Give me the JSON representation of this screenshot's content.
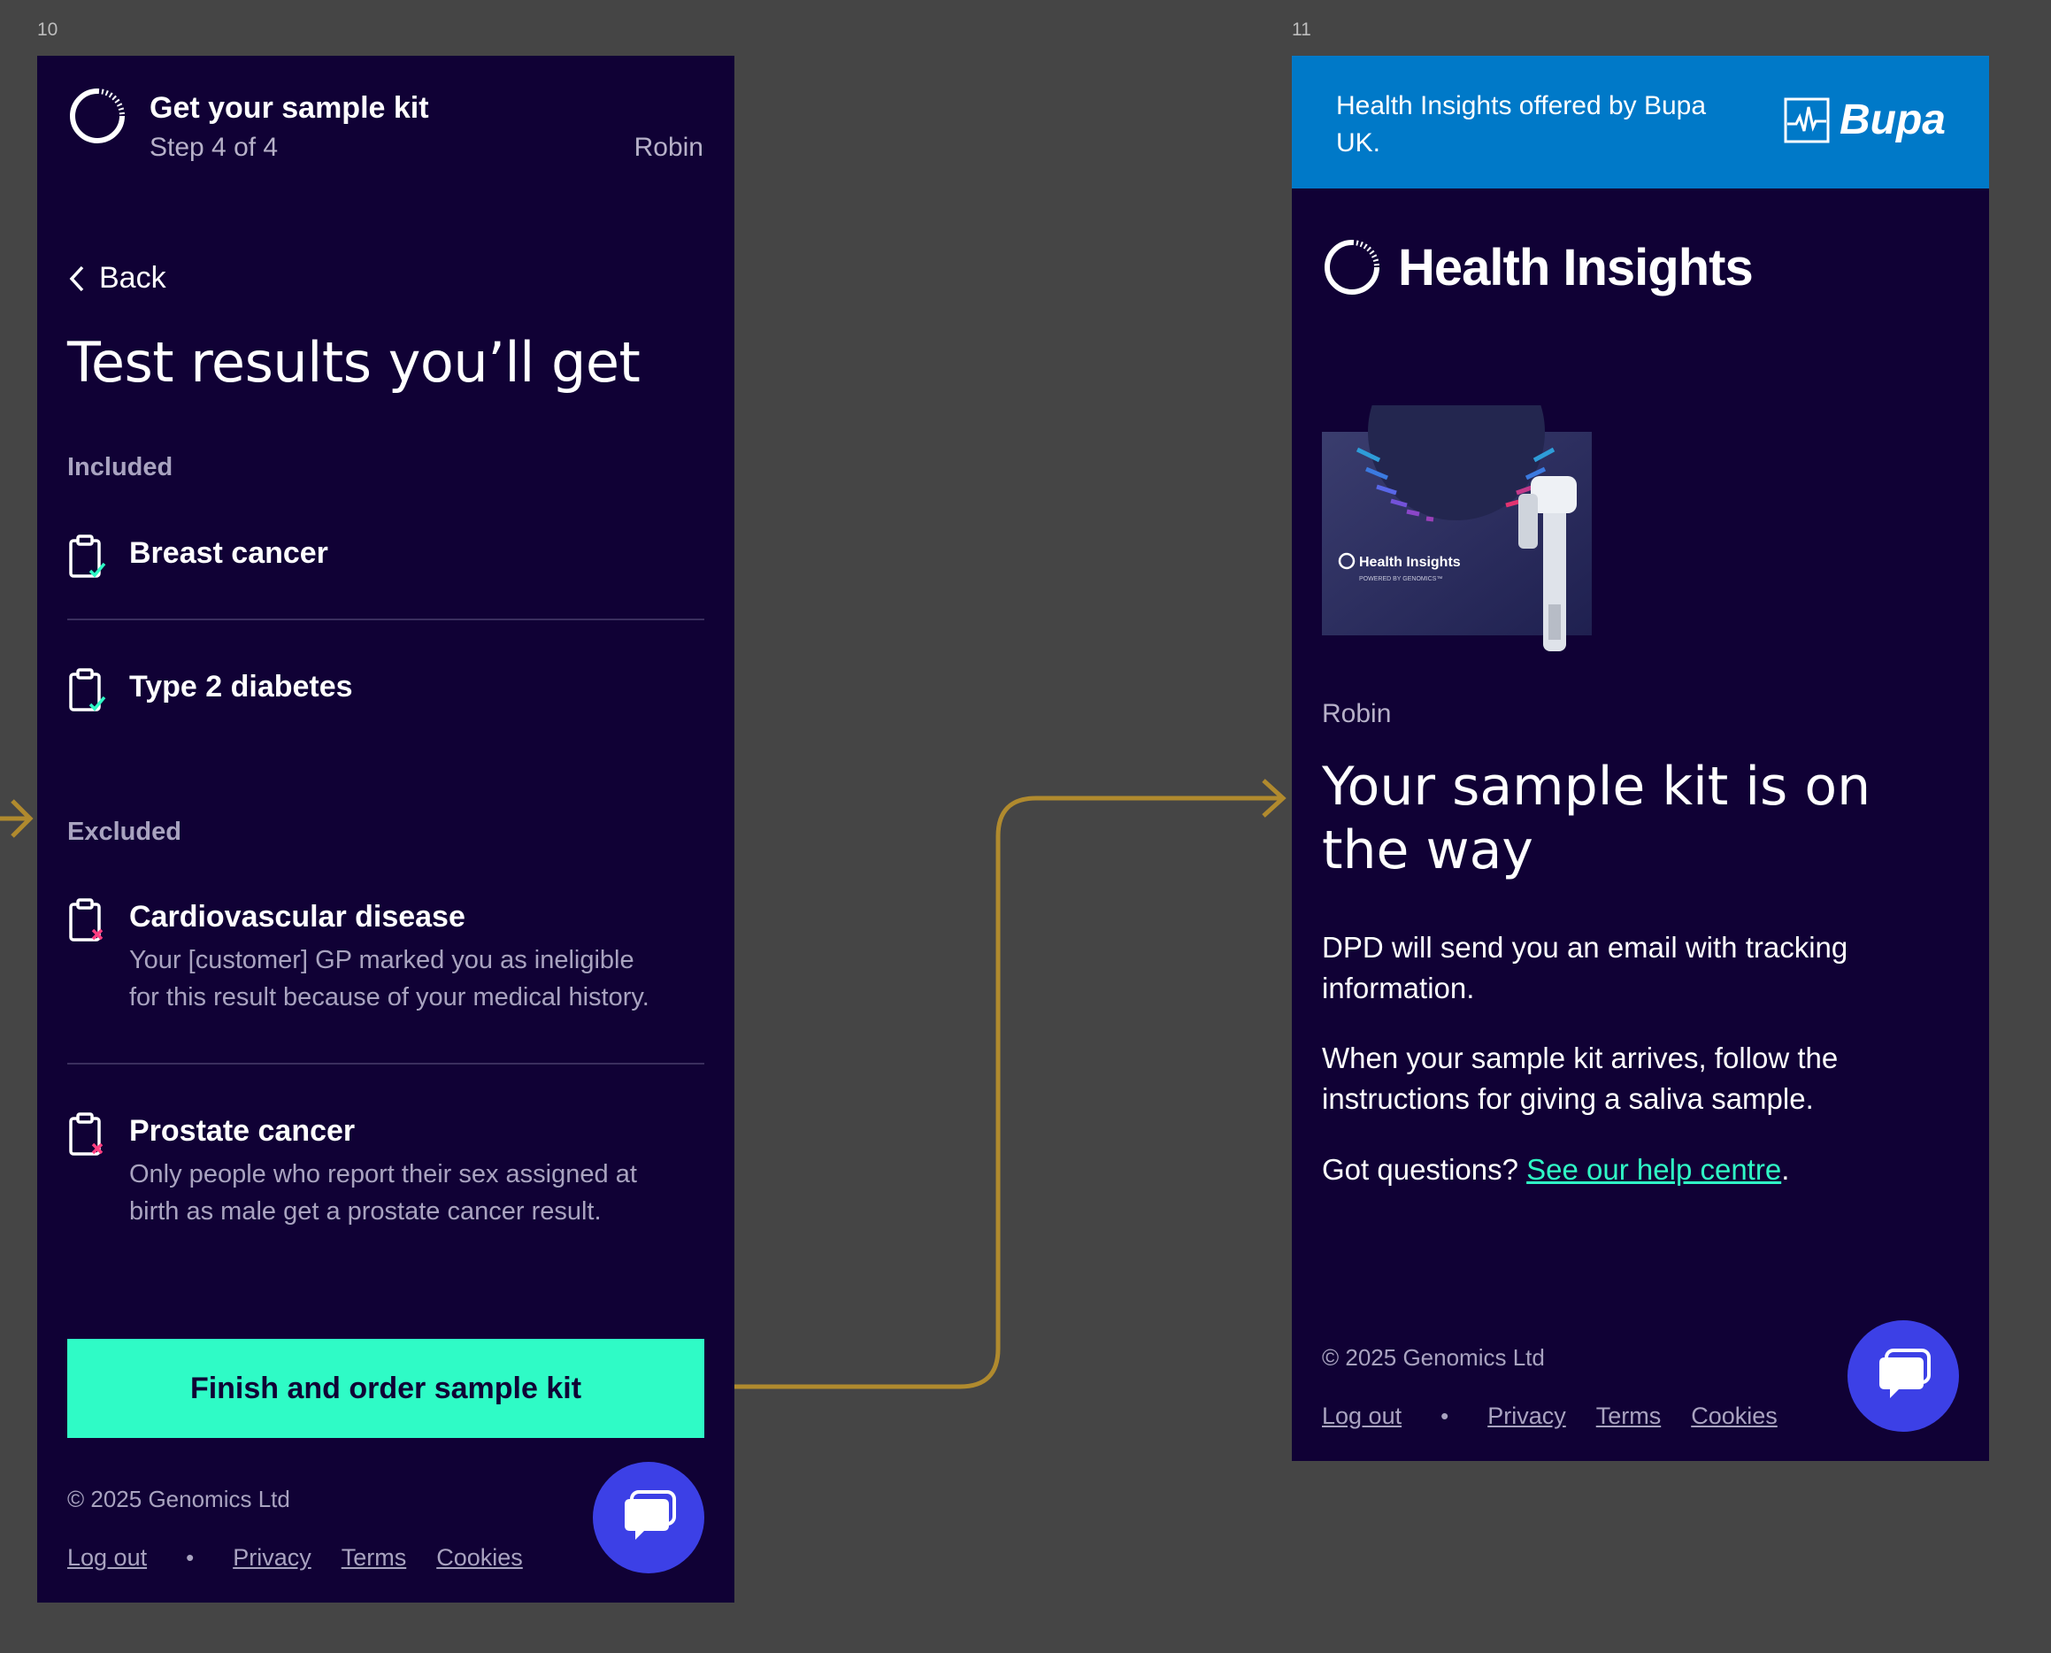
{
  "frames": [
    "10",
    "11"
  ],
  "screen10": {
    "header": {
      "title": "Get your sample kit",
      "step": "Step 4 of 4",
      "user": "Robin"
    },
    "back_label": "Back",
    "page_title": "Test results you’ll get",
    "included_label": "Included",
    "included": [
      {
        "title": "Breast cancer",
        "icon": "clipboard-check-icon"
      },
      {
        "title": "Type 2 diabetes",
        "icon": "clipboard-check-icon"
      }
    ],
    "excluded_label": "Excluded",
    "excluded": [
      {
        "title": "Cardiovascular disease",
        "desc1": "Your [customer] GP marked you as ineligible",
        "desc2": "for this result because of your medical history.",
        "icon": "clipboard-x-icon"
      },
      {
        "title": "Prostate cancer",
        "desc1": "Only people who report their sex assigned at",
        "desc2": "birth as male get a prostate cancer result.",
        "icon": "clipboard-x-icon"
      }
    ],
    "cta_label": "Finish and order sample kit",
    "footer": {
      "copyright": "© 2025 Genomics Ltd",
      "logout": "Log out",
      "separator": "•",
      "privacy": "Privacy",
      "terms": "Terms",
      "cookies": "Cookies"
    }
  },
  "screen11": {
    "banner_text": "Health Insights offered by Bupa UK.",
    "bupa_logo": "Bupa",
    "brand": "Health Insights",
    "kit_image": {
      "brand": "Health Insights",
      "sub": "POWERED BY GENOMICS™"
    },
    "user": "Robin",
    "page_title": "Your sample kit is on the way",
    "para1": "DPD will send you an email with tracking information.",
    "para2": "When your sample kit arrives, follow the instructions for giving a saliva sample.",
    "para3_prefix": "Got questions?",
    "help_link": "See our help centre",
    "para3_suffix": ".",
    "footer": {
      "copyright": "© 2025 Genomics Ltd",
      "logout": "Log out",
      "separator": "•",
      "privacy": "Privacy",
      "terms": "Terms",
      "cookies": "Cookies"
    }
  },
  "colors": {
    "page_bg": "#454545",
    "screen_bg": "#100135",
    "accent": "#2ffbc6",
    "chat": "#3c40e6",
    "bupa_blue": "#0079c8",
    "flow_arrow": "#b08a2e",
    "excluded_x": "#ff3d7f"
  }
}
